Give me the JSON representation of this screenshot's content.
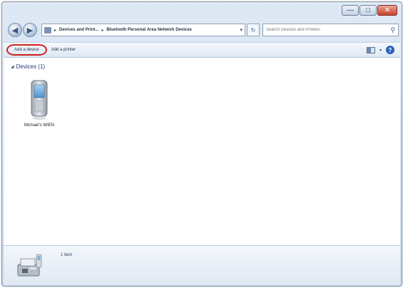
{
  "window": {
    "minimize_label": "—",
    "maximize_label": "□",
    "close_label": "✕"
  },
  "address": {
    "segments": [
      "Devices and Print...",
      "Bluetooth Personal Area Network Devices"
    ],
    "separator": "▸",
    "refresh_label": "↻",
    "search_placeholder": "Search Devices and Printers"
  },
  "toolbar": {
    "add_device": "Add a device",
    "add_printer": "Add a printer"
  },
  "content": {
    "group_label": "Devices (1)",
    "devices": [
      {
        "label": "Michael's WIEN",
        "icon": "mobile-phone-icon"
      }
    ]
  },
  "details": {
    "count": "1 item",
    "icon": "devices-printers-icon"
  },
  "colors": {
    "highlight_circle": "#d0201b",
    "link_blue": "#1e3a6e"
  }
}
